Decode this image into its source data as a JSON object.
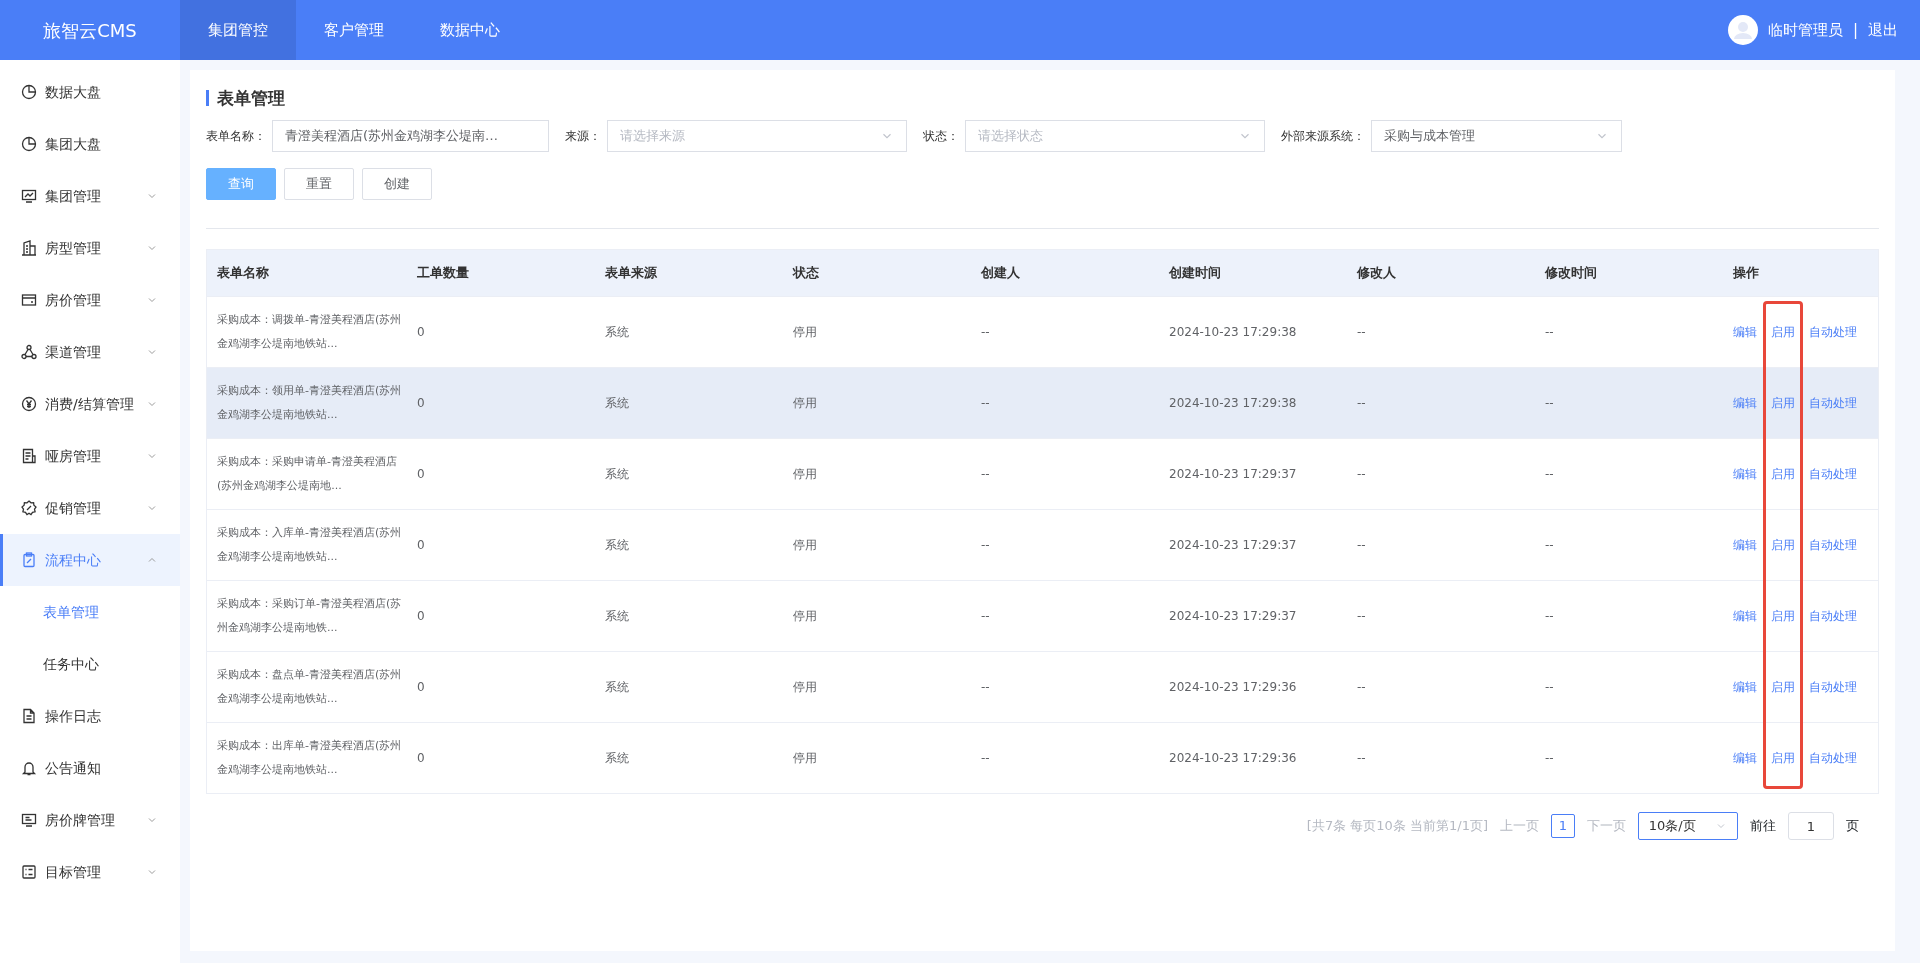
{
  "brand": "旅智云CMS",
  "top_nav": [
    {
      "label": "集团管控",
      "selected": true
    },
    {
      "label": "客户管理",
      "selected": false
    },
    {
      "label": "数据中心",
      "selected": false
    }
  ],
  "user": {
    "name": "临时管理员",
    "separator": "|",
    "logout": "退出"
  },
  "sidebar": [
    {
      "label": "数据大盘",
      "kind": "link",
      "selected": false
    },
    {
      "label": "集团大盘",
      "kind": "link",
      "selected": false
    },
    {
      "label": "集团管理",
      "kind": "group",
      "expanded": false,
      "selected": false
    },
    {
      "label": "房型管理",
      "kind": "group",
      "expanded": false,
      "selected": false
    },
    {
      "label": "房价管理",
      "kind": "group",
      "expanded": false,
      "selected": false
    },
    {
      "label": "渠道管理",
      "kind": "group",
      "expanded": false,
      "selected": false
    },
    {
      "label": "消费/结算管理",
      "kind": "group",
      "expanded": false,
      "selected": false
    },
    {
      "label": "哑房管理",
      "kind": "group",
      "expanded": false,
      "selected": false
    },
    {
      "label": "促销管理",
      "kind": "group",
      "expanded": false,
      "selected": false
    },
    {
      "label": "流程中心",
      "kind": "group",
      "expanded": true,
      "selected": true,
      "children": [
        {
          "label": "表单管理",
          "selected": true
        },
        {
          "label": "任务中心",
          "selected": false
        }
      ]
    },
    {
      "label": "操作日志",
      "kind": "link",
      "selected": false
    },
    {
      "label": "公告通知",
      "kind": "link",
      "selected": false
    },
    {
      "label": "房价牌管理",
      "kind": "group",
      "expanded": false,
      "selected": false
    },
    {
      "label": "目标管理",
      "kind": "group",
      "expanded": false,
      "selected": false
    }
  ],
  "page_title": "表单管理",
  "filters": [
    {
      "label": "表单名称：",
      "kind": "input",
      "value": "青澄美程酒店(苏州金鸡湖李公堤南…"
    },
    {
      "label": "来源：",
      "kind": "select",
      "placeholder": "请选择来源"
    },
    {
      "label": "状态：",
      "kind": "select",
      "placeholder": "请选择状态"
    },
    {
      "label": "外部来源系统：",
      "kind": "select",
      "value": "采购与成本管理"
    }
  ],
  "buttons": [
    {
      "label": "查询",
      "kind": "primary"
    },
    {
      "label": "重置",
      "kind": "default"
    },
    {
      "label": "创建",
      "kind": "default"
    }
  ],
  "table": {
    "columns": [
      "表单名称",
      "工单数量",
      "表单来源",
      "状态",
      "创建人",
      "创建时间",
      "修改人",
      "修改时间",
      "操作"
    ],
    "action_columns": [
      {
        "highlighted": false
      },
      {
        "highlighted": true
      },
      {
        "highlighted": false
      }
    ],
    "rows": [
      {
        "cells": [
          "采购成本：调拨单-青澄美程酒店(苏州金鸡湖李公堤南地铁站...",
          "0",
          "系统",
          "停用",
          "--",
          "2024-10-23 17:29:38",
          "--",
          "--"
        ],
        "hovered": false,
        "actions": [
          "编辑",
          "启用",
          "自动处理"
        ]
      },
      {
        "cells": [
          "采购成本：领用单-青澄美程酒店(苏州金鸡湖李公堤南地铁站...",
          "0",
          "系统",
          "停用",
          "--",
          "2024-10-23 17:29:38",
          "--",
          "--"
        ],
        "hovered": true,
        "actions": [
          "编辑",
          "启用",
          "自动处理"
        ]
      },
      {
        "cells": [
          "采购成本：采购申请单-青澄美程酒店(苏州金鸡湖李公堤南地...",
          "0",
          "系统",
          "停用",
          "--",
          "2024-10-23 17:29:37",
          "--",
          "--"
        ],
        "hovered": false,
        "actions": [
          "编辑",
          "启用",
          "自动处理"
        ]
      },
      {
        "cells": [
          "采购成本：入库单-青澄美程酒店(苏州金鸡湖李公堤南地铁站...",
          "0",
          "系统",
          "停用",
          "--",
          "2024-10-23 17:29:37",
          "--",
          "--"
        ],
        "hovered": false,
        "actions": [
          "编辑",
          "启用",
          "自动处理"
        ]
      },
      {
        "cells": [
          "采购成本：采购订单-青澄美程酒店(苏州金鸡湖李公堤南地铁...",
          "0",
          "系统",
          "停用",
          "--",
          "2024-10-23 17:29:37",
          "--",
          "--"
        ],
        "hovered": false,
        "actions": [
          "编辑",
          "启用",
          "自动处理"
        ]
      },
      {
        "cells": [
          "采购成本：盘点单-青澄美程酒店(苏州金鸡湖李公堤南地铁站...",
          "0",
          "系统",
          "停用",
          "--",
          "2024-10-23 17:29:36",
          "--",
          "--"
        ],
        "hovered": false,
        "actions": [
          "编辑",
          "启用",
          "自动处理"
        ]
      },
      {
        "cells": [
          "采购成本：出库单-青澄美程酒店(苏州金鸡湖李公堤南地铁站...",
          "0",
          "系统",
          "停用",
          "--",
          "2024-10-23 17:29:36",
          "--",
          "--"
        ],
        "hovered": false,
        "actions": [
          "编辑",
          "启用",
          "自动处理"
        ]
      }
    ]
  },
  "pagination": {
    "summary": "[共7条 每页10条 当前第1/1页]",
    "prev": "上一页",
    "pages": [
      {
        "label": "1",
        "selected": true
      }
    ],
    "next": "下一页",
    "page_size": "10条/页",
    "goto_label": "前往",
    "goto_value": "1",
    "goto_suffix": "页"
  }
}
